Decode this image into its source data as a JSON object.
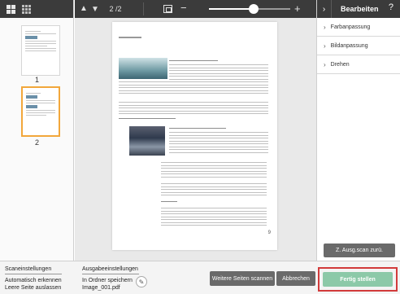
{
  "viewer": {
    "page_counter": "2 /2",
    "zoom_level": 0.55
  },
  "thumbnails": [
    {
      "number": "1"
    },
    {
      "number": "2"
    }
  ],
  "document": {
    "page_number": "9"
  },
  "right_panel": {
    "title": "Bearbeiten",
    "help": "?",
    "sections": [
      "Farbanpassung",
      "Bildanpassung",
      "Drehen"
    ],
    "reset_button": "Z. Ausg.scan zurü."
  },
  "bottom_bar": {
    "scan_settings": {
      "heading": "Scaneinstellungen",
      "lines": [
        "Automatisch erkennen",
        "Leere Seite auslassen"
      ]
    },
    "output_settings": {
      "heading": "Ausgabeeinstellungen",
      "lines": [
        "In Ordner speichern",
        "Image_001.pdf"
      ]
    },
    "scan_more_button": "Weitere Seiten scannen",
    "cancel_button": "Abbrechen",
    "finish_button": "Fertig stellen"
  },
  "colors": {
    "toolbar": "#3b3b3b",
    "selected_thumbnail": "#f2a73b",
    "finish_button": "#8cc9a8",
    "highlight_border": "#d23b3b"
  }
}
